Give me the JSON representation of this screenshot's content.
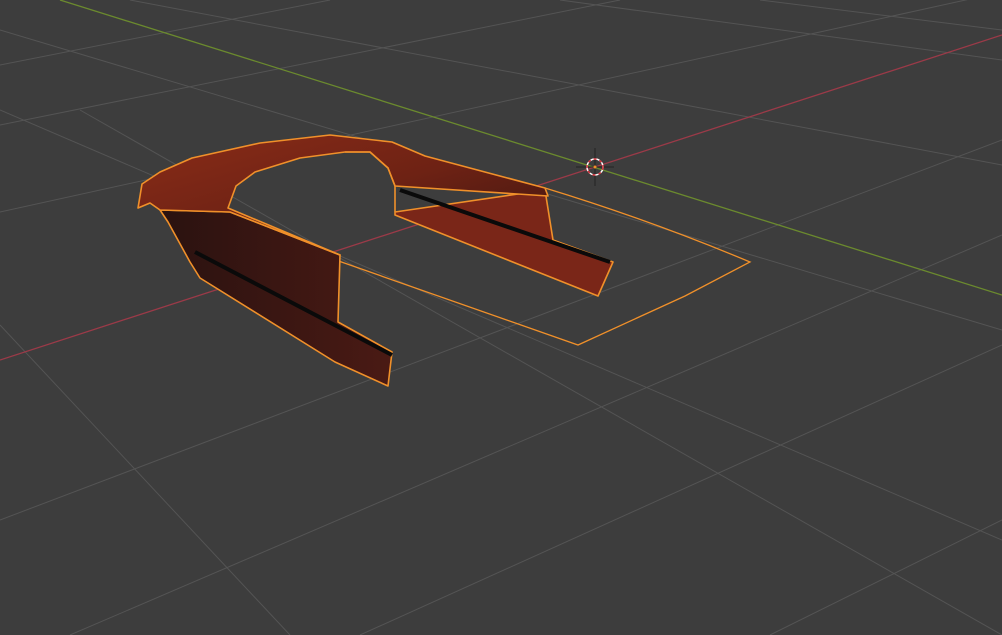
{
  "viewport": {
    "background_color": "#3d3d3d",
    "grid_color": "#545454",
    "x_axis_color": "#9b3a48",
    "y_axis_color": "#6b8a2e",
    "selection_outline_color": "#f0902a",
    "mesh_color": "#7a2618"
  },
  "cursor": {
    "icon": "3d-cursor-icon"
  }
}
